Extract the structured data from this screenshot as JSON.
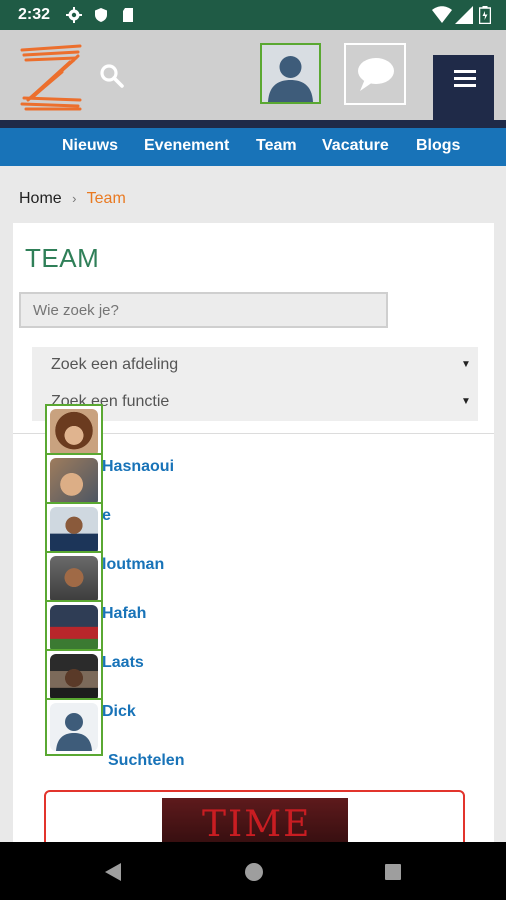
{
  "status_bar": {
    "time": "2:32",
    "left_icons": [
      "settings-icon",
      "shield-icon",
      "sd-card-icon"
    ],
    "right_icons": [
      "wifi-icon",
      "signal-icon",
      "battery-icon"
    ]
  },
  "header": {
    "logo_icon": "zoot-logo",
    "search_icon": "search-icon",
    "profile_icon": "default-avatar-icon",
    "chat_icon": "chat-bubble-icon",
    "menu_icon": "hamburger-menu-icon"
  },
  "nav": {
    "items": [
      {
        "label": "Nieuws"
      },
      {
        "label": "Evenement"
      },
      {
        "label": "Team"
      },
      {
        "label": "Vacature"
      },
      {
        "label": "Blogs"
      }
    ]
  },
  "breadcrumb": {
    "home": "Home",
    "separator": "›",
    "current": "Team"
  },
  "page": {
    "title": "TEAM",
    "search_placeholder": "Wie zoek je?",
    "department_select": "Zoek een afdeling",
    "function_select": "Zoek een functie"
  },
  "team": {
    "members": [
      {
        "name_visible": "Hasnaoui",
        "avatar": "woman-curly-hair-photo"
      },
      {
        "name_visible": "e",
        "avatar": "smiling-man-photo"
      },
      {
        "name_visible": "loutman",
        "avatar": "man-dark-shirt-photo"
      },
      {
        "name_visible": "Hafah",
        "avatar": "man-beard-photo"
      },
      {
        "name_visible": "Laats",
        "avatar": "football-player-photo"
      },
      {
        "name_visible": "Dick",
        "avatar": "man-cap-photo"
      },
      {
        "name_visible": "Suchtelen",
        "avatar": "default-avatar-icon"
      }
    ]
  },
  "promo": {
    "time_word": "TIME",
    "border_color": "#e2342c"
  },
  "colors": {
    "status_bar": "#1f5b45",
    "nav": "#1873b8",
    "menu_dark": "#1f2a48",
    "accent_orange": "#e97a22",
    "title_green": "#2f7f58",
    "avatar_border": "#5aa832"
  },
  "system_nav": {
    "icons": [
      "back-icon",
      "home-icon",
      "recents-icon"
    ]
  }
}
